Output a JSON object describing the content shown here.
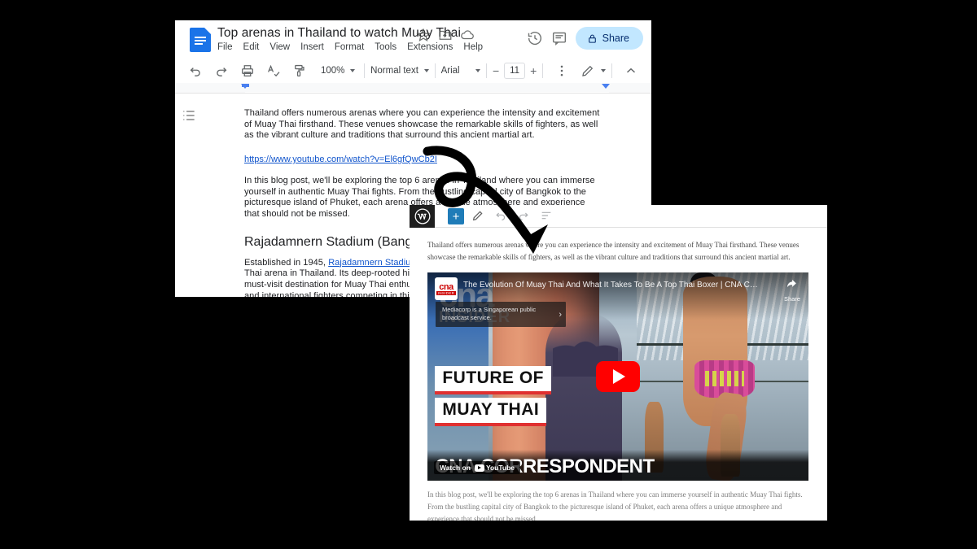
{
  "gdocs": {
    "title": "Top arenas in Thailand to watch Muay Thai",
    "menu": [
      "File",
      "Edit",
      "View",
      "Insert",
      "Format",
      "Tools",
      "Extensions",
      "Help"
    ],
    "title_icons": [
      "star-icon",
      "move-to-folder-icon",
      "cloud-saved-icon"
    ],
    "header_actions": [
      "history-icon",
      "comment-icon"
    ],
    "share_label": "Share",
    "share_icon": "lock-icon",
    "share_bg": "#c2e7ff",
    "toolbar": {
      "undo_icon": "undo-icon",
      "redo_icon": "redo-icon",
      "print_icon": "print-icon",
      "spellcheck_icon": "spellcheck-icon",
      "paint_format_icon": "paint-format-icon",
      "zoom": "100%",
      "style": "Normal text",
      "font": "Arial",
      "font_size": "11",
      "decrease_label": "−",
      "increase_label": "+",
      "more_icon": "more-options-icon",
      "mode_icon": "edit-mode-pencil-icon",
      "collapse_icon": "collapse-toolbar-icon"
    },
    "outline_icon": "document-outline-icon",
    "paragraphs": {
      "p1": "Thailand offers numerous arenas where you can experience the intensity and excitement of Muay Thai firsthand. These venues showcase the remarkable skills of fighters, as well as the vibrant culture and traditions that surround this ancient martial art.",
      "link": "https://www.youtube.com/watch?v=El6gfQwCb2I",
      "p2": "In this blog post, we'll be exploring the top 6 arenas in Thailand where you can immerse yourself in authentic Muay Thai fights. From the bustling capital city of Bangkok to the picturesque island of Phuket, each arena offers a unique atmosphere and experience that should not be missed.",
      "heading": "Rajadamnern Stadium (Bangkok)",
      "p3_before": "Established in 1945, ",
      "p3_link": "Rajadamnern Stadium",
      "p3_after": " holds the distinction of being the oldest Muay Thai arena in Thailand. Its deep-rooted history and traditional ambiance have made it a must-visit destination for Muay Thai enthusiasts. It hosts legendary fights, with both local and international fighters competing in this iconic venue."
    }
  },
  "wordpress": {
    "logo_icon": "wordpress-logo-icon",
    "add_block_label": "+",
    "add_block_icon": "add-block-icon",
    "tools": [
      "tools-pencil-icon",
      "undo-icon",
      "redo-icon",
      "document-overview-icon"
    ],
    "paragraphs": {
      "p1": "Thailand offers numerous arenas where you can experience the intensity and excitement of Muay Thai firsthand. These venues showcase the remarkable skills of fighters, as well as the vibrant culture and traditions that surround this ancient martial art.",
      "p2": "In this blog post, we'll be exploring the top 6 arenas in Thailand where you can immerse yourself in authentic Muay Thai fights. From the bustling capital city of Bangkok to the picturesque island of Phuket, each arena offers a unique atmosphere and experience that should not be missed."
    },
    "video": {
      "title": "The Evolution Of Muay Thai And What It Takes To Be A Top Thai Boxer | CNA Correspo...",
      "channel_name": "cna",
      "channel_sub": "INSIDER",
      "info_card": "Mediacorp is a Singaporean public broadcast service.",
      "share_label": "Share",
      "share_icon": "share-arrow-icon",
      "play_icon": "youtube-play-button-icon",
      "play_color": "#ff0000",
      "watch_on_label": "Watch on",
      "watch_on_brand": "YouTube",
      "thumb_watermark": "cna",
      "thumb_watermark_sub": "INSIDER",
      "thumb_title_line1": "FUTURE OF",
      "thumb_title_line2": "MUAY THAI",
      "thumb_footer": "CNA CORRESPONDENT"
    }
  },
  "annotation": {
    "shape": "curved-looping-arrow",
    "color": "#000000"
  }
}
